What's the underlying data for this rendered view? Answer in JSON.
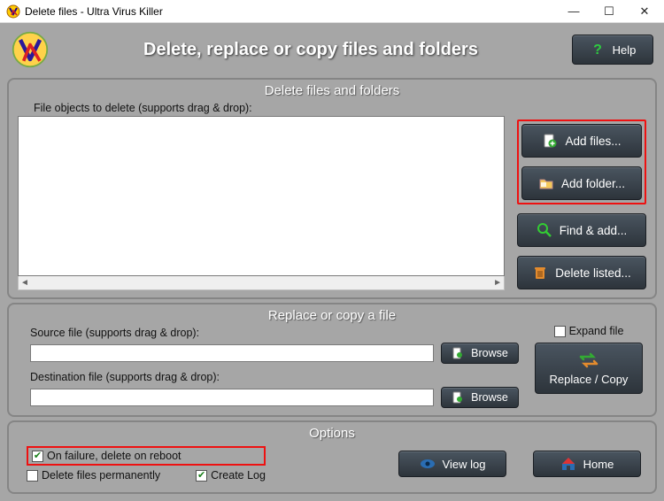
{
  "window": {
    "title": "Delete files - Ultra Virus Killer"
  },
  "header": {
    "title": "Delete, replace or copy files and folders",
    "help_label": "Help"
  },
  "delete_section": {
    "title": "Delete files and folders",
    "list_label": "File objects to delete (supports drag & drop):",
    "buttons": {
      "add_files": "Add files...",
      "add_folder": "Add folder...",
      "find_add": "Find & add...",
      "delete_listed": "Delete listed..."
    }
  },
  "replace_section": {
    "title": "Replace or copy a file",
    "source_label": "Source file (supports drag & drop):",
    "dest_label": "Destination file (supports drag & drop):",
    "browse_label": "Browse",
    "expand_label": "Expand file",
    "replace_label": "Replace / Copy",
    "source_value": "",
    "dest_value": ""
  },
  "options_section": {
    "title": "Options",
    "on_failure_label": "On failure, delete on reboot",
    "delete_perm_label": "Delete files permanently",
    "create_log_label": "Create Log",
    "view_log_label": "View log",
    "home_label": "Home",
    "on_failure_checked": true,
    "delete_perm_checked": false,
    "create_log_checked": true
  }
}
